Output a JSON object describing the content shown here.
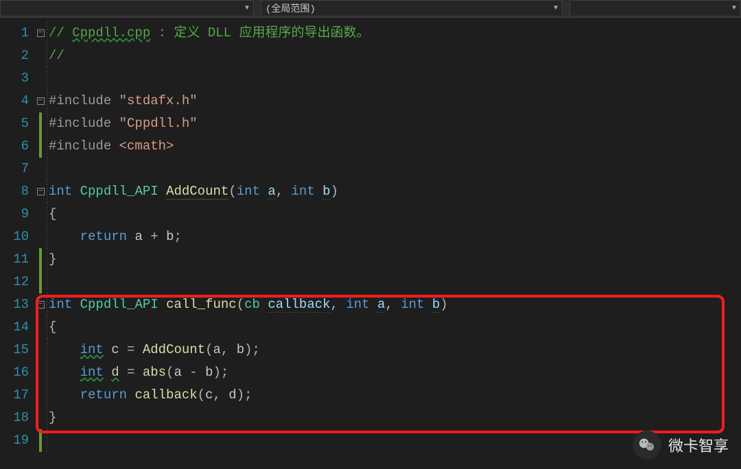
{
  "toolbar": {
    "dd1_label": "",
    "dd2_label": "(全局范围)",
    "dd3_label": ""
  },
  "gutter": {
    "lines": [
      "1",
      "2",
      "3",
      "4",
      "5",
      "6",
      "7",
      "8",
      "9",
      "10",
      "11",
      "12",
      "13",
      "14",
      "15",
      "16",
      "17",
      "18",
      "19"
    ]
  },
  "code": {
    "l1": {
      "pre": "// ",
      "file": "Cppdll.cpp",
      "rest": " : 定义 DLL 应用程序的导出函数。"
    },
    "l2": {
      "text": "//"
    },
    "l3": {
      "text": ""
    },
    "l4": {
      "inc": "#include",
      "str": "\"stdafx.h\""
    },
    "l5": {
      "inc": "#include",
      "str": "\"Cppdll.h\""
    },
    "l6": {
      "inc": "#include",
      "ang": "<cmath>"
    },
    "l7": {
      "text": ""
    },
    "l8": {
      "kw": "int",
      "api": "Cppdll_API",
      "fn": "AddCount",
      "p1t": "int",
      "p1n": "a",
      "p2t": "int",
      "p2n": "b"
    },
    "l9": {
      "brace": "{"
    },
    "l10": {
      "kw": "return",
      "e1": "a",
      "op": "+",
      "e2": "b"
    },
    "l11": {
      "brace": "}"
    },
    "l12": {
      "text": ""
    },
    "l13": {
      "kw": "int",
      "api": "Cppdll_API",
      "fn": "call_func",
      "p1t": "cb",
      "p1n": "callback",
      "p2t": "int",
      "p2n": "a",
      "p3t": "int",
      "p3n": "b"
    },
    "l14": {
      "brace": "{"
    },
    "l15": {
      "t": "int",
      "v": "c",
      "fn": "AddCount",
      "a1": "a",
      "a2": "b"
    },
    "l16": {
      "t": "int",
      "v": "d",
      "fn": "abs",
      "a1": "a",
      "op": "-",
      "a2": "b"
    },
    "l17": {
      "kw": "return",
      "fn": "callback",
      "a1": "c",
      "a2": "d"
    },
    "l18": {
      "brace": "}"
    },
    "l19": {
      "text": ""
    }
  },
  "watermark": {
    "text": "微卡智享"
  }
}
